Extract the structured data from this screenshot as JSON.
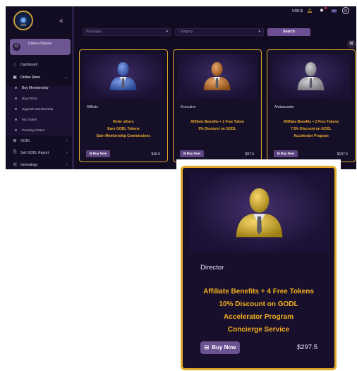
{
  "sidebar": {
    "logo_text": "GTS",
    "collapse_icon": "double-chevron-left-icon",
    "user": {
      "initial": "D",
      "name": "Dianna Dianna"
    },
    "items": [
      {
        "label": "Dashboard",
        "icon": "dashboard-icon"
      },
      {
        "label": "Online Store",
        "icon": "store-icon",
        "expanded": true
      },
      {
        "label": "Buy Membership",
        "sub": true
      },
      {
        "label": "Buy GODL",
        "sub": true
      },
      {
        "label": "Upgrade Membership",
        "sub": true
      },
      {
        "label": "My Orders",
        "sub": true
      },
      {
        "label": "Pending Orders",
        "sub": true
      },
      {
        "label": "GODL",
        "icon": "grid-icon"
      },
      {
        "label": "Sell GODL Report",
        "icon": "report-icon"
      },
      {
        "label": "Genealogy",
        "icon": "network-icon"
      }
    ]
  },
  "topbar": {
    "currency": "USD $",
    "avatar_initial": "D"
  },
  "filters": {
    "packages_placeholder": "Packages",
    "category_placeholder": "Category",
    "search_label": "Search"
  },
  "cards": [
    {
      "tier": "Affiliate",
      "figure_color": "#3a6be0",
      "benefits": [
        "Refer others",
        "Earn GODL Tokens",
        "Earn Membership Commissions"
      ],
      "buy_label": "Buy Now",
      "price": "$49.5"
    },
    {
      "tier": "Executive",
      "figure_color": "#d9761f",
      "benefits": [
        "Affiliate Benefits + 1 Free Token",
        "5% Discount on GODL"
      ],
      "buy_label": "Buy Now",
      "price": "$97.5"
    },
    {
      "tier": "Ambassador",
      "figure_color": "#b5b5bd",
      "benefits": [
        "Affiliate Benefits + 2 Free Tokens",
        "7.5% Discount on GODL",
        "Accelerator Program"
      ],
      "buy_label": "Buy Now",
      "price": "$197.5"
    }
  ],
  "zoom_card": {
    "tier": "Director",
    "figure_color": "#f2c21a",
    "benefits": [
      "Affiliate Benefits + 4 Free Tokens",
      "10% Discount on GODL",
      "Accelerator Program",
      "Concierge Service"
    ],
    "buy_label": "Buy Now",
    "price": "$297.5"
  },
  "colors": {
    "accent_gold": "#e0a92a",
    "benefit_text": "#f3b02a",
    "button_purple": "#6b5290",
    "background": "#120c22"
  }
}
